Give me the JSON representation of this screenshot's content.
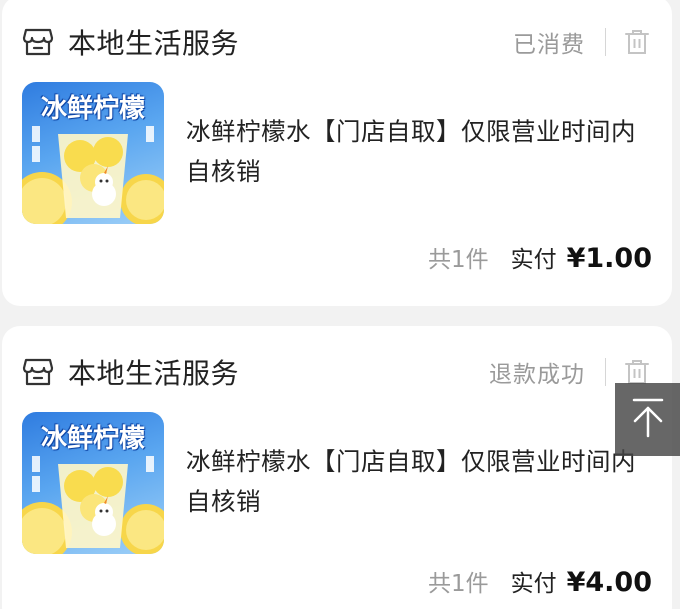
{
  "orders": [
    {
      "shop_name": "本地生活服务",
      "status": "已消费",
      "product": {
        "image_caption": "冰鲜柠檬",
        "title": "冰鲜柠檬水【门店自取】仅限营业时间内自核销"
      },
      "quantity_text": "共1件",
      "paid_label": "实付",
      "price": "¥1.00"
    },
    {
      "shop_name": "本地生活服务",
      "status": "退款成功",
      "product": {
        "image_caption": "冰鲜柠檬",
        "title": "冰鲜柠檬水【门店自取】仅限营业时间内自核销"
      },
      "quantity_text": "共1件",
      "paid_label": "实付",
      "price": "¥4.00"
    }
  ],
  "icons": {
    "shop": "store-icon",
    "delete": "trash-icon",
    "back_to_top": "arrow-up-icon"
  }
}
